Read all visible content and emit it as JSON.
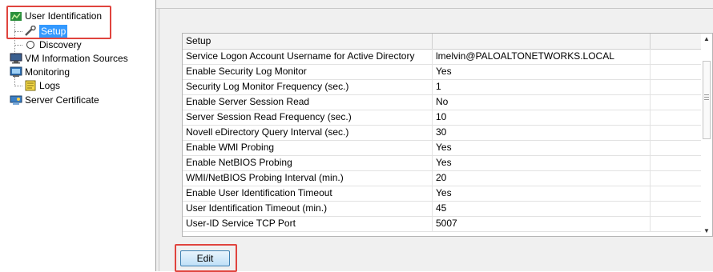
{
  "tree": {
    "items": [
      {
        "label": "User Identification",
        "icon": "user-identification-icon"
      },
      {
        "label": "Setup",
        "icon": "setup-wrench-icon",
        "selected": true
      },
      {
        "label": "Discovery",
        "icon": "discovery-radio-icon"
      },
      {
        "label": "VM Information Sources",
        "icon": "vm-monitor-icon"
      },
      {
        "label": "Monitoring",
        "icon": "monitoring-icon"
      },
      {
        "label": "Logs",
        "icon": "logs-icon"
      },
      {
        "label": "Server Certificate",
        "icon": "server-certificate-icon"
      }
    ]
  },
  "grid": {
    "header": "Setup",
    "rows": [
      {
        "name": "Service Logon Account Username for Active Directory",
        "value": "lmelvin@PALOALTONETWORKS.LOCAL"
      },
      {
        "name": "Enable Security Log Monitor",
        "value": "Yes"
      },
      {
        "name": "Security Log Monitor Frequency (sec.)",
        "value": "1"
      },
      {
        "name": "Enable Server Session Read",
        "value": "No"
      },
      {
        "name": "Server Session Read Frequency (sec.)",
        "value": "10"
      },
      {
        "name": "Novell eDirectory Query Interval (sec.)",
        "value": "30"
      },
      {
        "name": "Enable WMI Probing",
        "value": "Yes"
      },
      {
        "name": "Enable NetBIOS Probing",
        "value": "Yes"
      },
      {
        "name": "WMI/NetBIOS Probing Interval (min.)",
        "value": "20"
      },
      {
        "name": "Enable User Identification Timeout",
        "value": "Yes"
      },
      {
        "name": "User Identification Timeout (min.)",
        "value": "45"
      },
      {
        "name": "User-ID Service TCP Port",
        "value": "5007"
      }
    ]
  },
  "buttons": {
    "edit": "Edit"
  },
  "colors": {
    "highlight_box": "#e0443e",
    "selection": "#3399ff"
  }
}
